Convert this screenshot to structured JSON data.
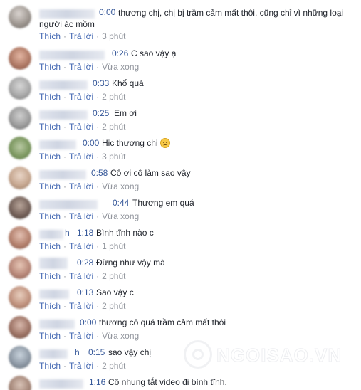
{
  "actions": {
    "like": "Thích",
    "reply": "Trả lời",
    "separator": "·"
  },
  "comments": [
    {
      "time": "0:00",
      "text": "thương chị, chị bị trầm cảm mất thôi. cũng chỉ vì những loại người ác mồm",
      "age": "3 phút"
    },
    {
      "time": "0:26",
      "text": "C sao vậy ạ",
      "age": "Vừa xong"
    },
    {
      "time": "0:33",
      "text": "Khổ quá",
      "age": "2 phút"
    },
    {
      "time": "0:25",
      "text": "Em ơi",
      "age": "2 phút"
    },
    {
      "time": "0:00",
      "text": "Hic thương chị",
      "age": "3 phút",
      "emoji": "sad-face-emoji"
    },
    {
      "time": "0:58",
      "text": "Cô ơi cô làm sao vậy",
      "age": "Vừa xong"
    },
    {
      "time": "0:44",
      "text": "Thương em quá",
      "age": "Vừa xong"
    },
    {
      "name_partial": "h",
      "time": "1:18",
      "text": "Bình tĩnh nào c",
      "age": "1 phút"
    },
    {
      "time": "0:28",
      "text": "Đừng như vậy mà",
      "age": "2 phút"
    },
    {
      "time": "0:13",
      "text": "Sao vậy c",
      "age": "2 phút"
    },
    {
      "time": "0:00",
      "text": "thương cô quá trầm cảm mất thôi",
      "age": "Vừa xong"
    },
    {
      "name_partial": "h",
      "time": "0:15",
      "text": "sao vậy chị",
      "age": "2 phút"
    },
    {
      "time": "1:16",
      "text": "Cô nhung tắt video đi bình tĩnh.",
      "age": ""
    }
  ],
  "watermark": {
    "text": "NGOISAO.VN"
  },
  "colors": {
    "link": "#4267b2",
    "time": "#365899",
    "text": "#1d2129",
    "muted": "#90949c"
  }
}
